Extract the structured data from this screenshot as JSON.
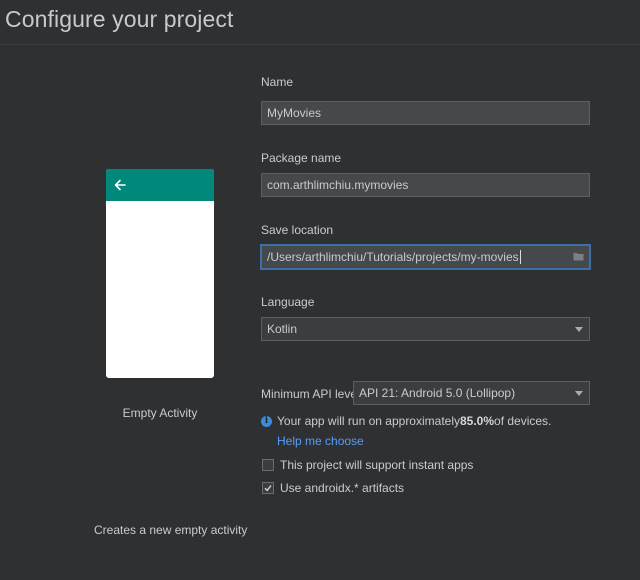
{
  "page": {
    "title": "Configure your project"
  },
  "template": {
    "name": "Empty Activity",
    "description": "Creates a new empty activity",
    "icon": "arrow-back-icon",
    "appbar_color": "#00897b"
  },
  "form": {
    "name": {
      "label": "Name",
      "value": "MyMovies"
    },
    "package_name": {
      "label": "Package name",
      "value": "com.arthlimchiu.mymovies"
    },
    "save_location": {
      "label": "Save location",
      "value": "/Users/arthlimchiu/Tutorials/projects/my-movies",
      "icon": "folder-icon"
    },
    "language": {
      "label": "Language",
      "selected": "Kotlin"
    },
    "min_api": {
      "label": "Minimum API level",
      "selected": "API 21: Android 5.0 (Lollipop)"
    },
    "info": {
      "icon": "info-icon",
      "prefix": "Your app will run on approximately ",
      "percent": "85.0%",
      "suffix": " of devices.",
      "help_link": "Help me choose"
    },
    "instant_apps": {
      "label": "This project will support instant apps",
      "checked": false
    },
    "androidx": {
      "label": "Use androidx.* artifacts",
      "checked": true
    }
  },
  "colors": {
    "background": "#2f3032",
    "focus_border": "#3d6ea8",
    "link": "#589df6",
    "info_icon": "#3d8bd9"
  }
}
